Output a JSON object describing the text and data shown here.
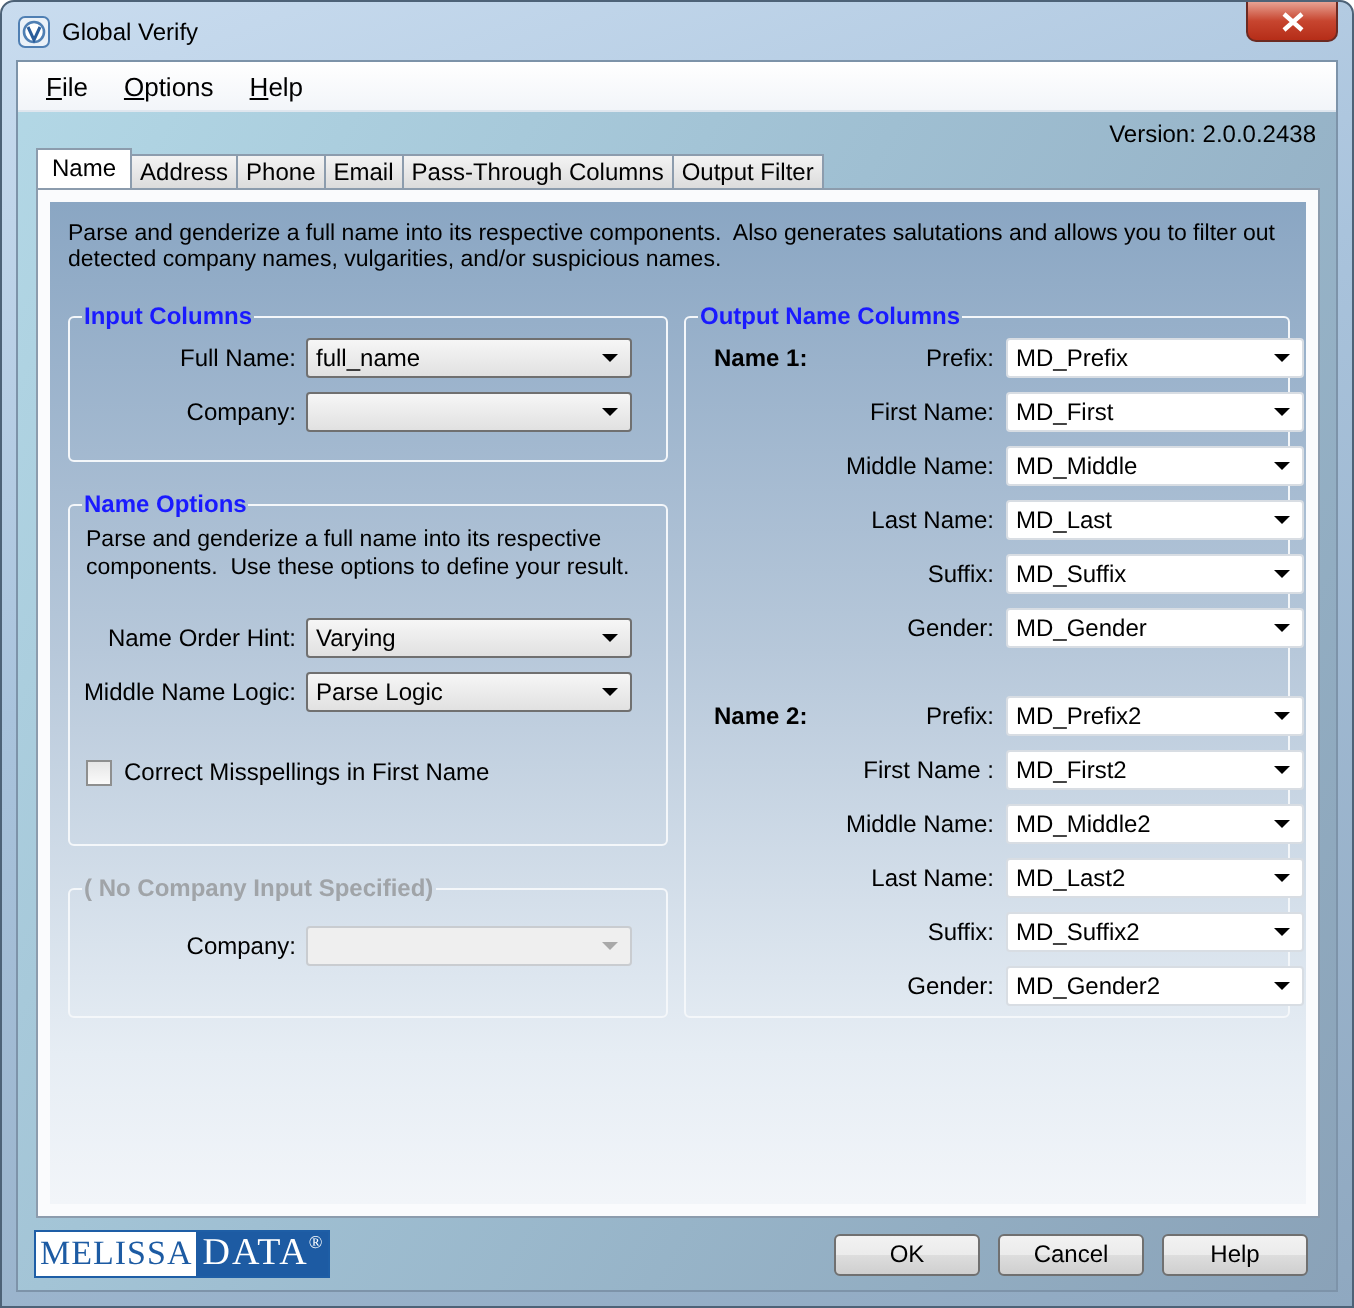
{
  "window": {
    "title": "Global Verify"
  },
  "menu": [
    {
      "access_key": "F",
      "rest": "ile"
    },
    {
      "access_key": "O",
      "rest": "ptions"
    },
    {
      "access_key": "H",
      "rest": "elp"
    }
  ],
  "version": "Version: 2.0.0.2438",
  "tabs": [
    {
      "label": "Name",
      "selected": true
    },
    {
      "label": "Address",
      "selected": false
    },
    {
      "label": "Phone",
      "selected": false
    },
    {
      "label": "Email",
      "selected": false
    },
    {
      "label": "Pass-Through Columns",
      "selected": false
    },
    {
      "label": "Output Filter",
      "selected": false
    }
  ],
  "description": "Parse and genderize a full name into its respective components.  Also generates salutations and allows you to filter out detected company names, vulgarities, and/or suspicious names.",
  "input_columns": {
    "title": "Input Columns",
    "disabled": false,
    "fields": [
      {
        "label": "Full Name:",
        "value": "full_name"
      },
      {
        "label": "Company:"
      }
    ]
  },
  "name_options": {
    "title": "Name Options",
    "description": "Parse and genderize a full name into its respective components.  Use these options to define your result.",
    "fields": [
      {
        "label": "Name Order Hint:",
        "value": "Varying"
      },
      {
        "label": "Middle Name Logic:",
        "value": "Parse Logic"
      }
    ],
    "checkbox": {
      "label": "Correct Misspellings in First Name",
      "checked": false
    }
  },
  "company_group": {
    "title": "( No Company Input Specified)",
    "disabled": true,
    "fields": [
      {
        "label": "Company:"
      }
    ]
  },
  "output": {
    "title": "Output Name Columns",
    "sets": [
      {
        "heading": "Name 1:",
        "fields": [
          {
            "label": "Prefix:",
            "value": "MD_Prefix"
          },
          {
            "label": "First Name:",
            "value": "MD_First"
          },
          {
            "label": "Middle Name:",
            "value": "MD_Middle"
          },
          {
            "label": "Last Name:",
            "value": "MD_Last"
          },
          {
            "label": "Suffix:",
            "value": "MD_Suffix"
          },
          {
            "label": "Gender:",
            "value": "MD_Gender"
          }
        ]
      },
      {
        "heading": "Name 2:",
        "fields": [
          {
            "label": "Prefix:",
            "value": "MD_Prefix2"
          },
          {
            "label": "First Name :",
            "value": "MD_First2"
          },
          {
            "label": "Middle Name:",
            "value": "MD_Middle2"
          },
          {
            "label": "Last Name:",
            "value": "MD_Last2"
          },
          {
            "label": "Suffix:",
            "value": "MD_Suffix2"
          },
          {
            "label": "Gender:",
            "value": "MD_Gender2"
          }
        ]
      }
    ]
  },
  "logo": {
    "text": "MELISSA",
    "highlight": "DATA",
    "mark": "®"
  },
  "buttons": [
    "OK",
    "Cancel",
    "Help"
  ]
}
